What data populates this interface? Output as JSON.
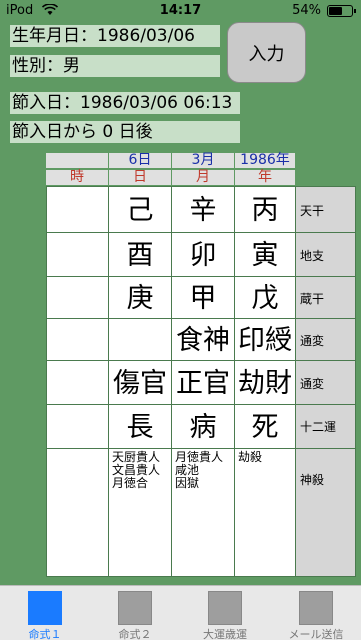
{
  "status": {
    "carrier": "iPod",
    "time": "14:17",
    "battery": "54%",
    "battery_level": 0.54
  },
  "info": {
    "birth": "生年月日：1986/03/06",
    "gender": "性別：男",
    "setsu_date": "節入日：1986/03/06 06:13",
    "after": "節入日から 0 日後",
    "input_button": "入力"
  },
  "header": {
    "day": "6日",
    "month": "3月",
    "year": "1986年",
    "col_hour": "時",
    "col_day": "日",
    "col_month": "月",
    "col_year": "年"
  },
  "rows": [
    {
      "label": "天干",
      "hour": "",
      "day": "己",
      "month": "辛",
      "year": "丙"
    },
    {
      "label": "地支",
      "hour": "",
      "day": "酉",
      "month": "卯",
      "year": "寅"
    },
    {
      "label": "蔵干",
      "hour": "",
      "day": "庚",
      "month": "甲",
      "year": "戊"
    },
    {
      "label": "通変",
      "hour": "",
      "day": "",
      "month": "食神",
      "year": "印綬"
    },
    {
      "label": "通変",
      "hour": "",
      "day": "傷官",
      "month": "正官",
      "year": "劫財"
    },
    {
      "label": "十二運",
      "hour": "",
      "day": "長",
      "month": "病",
      "year": "死"
    }
  ],
  "shinsatsu": {
    "label": "神殺",
    "hour": "",
    "day": "天厨貴人\n文昌貴人\n月徳合",
    "month": "月徳貴人\n咸池\n因獄",
    "year": "劫殺"
  },
  "tabs": [
    {
      "label": "命式１",
      "active": true
    },
    {
      "label": "命式２",
      "active": false
    },
    {
      "label": "大運歳運",
      "active": false
    },
    {
      "label": "メール送信",
      "active": false
    }
  ]
}
